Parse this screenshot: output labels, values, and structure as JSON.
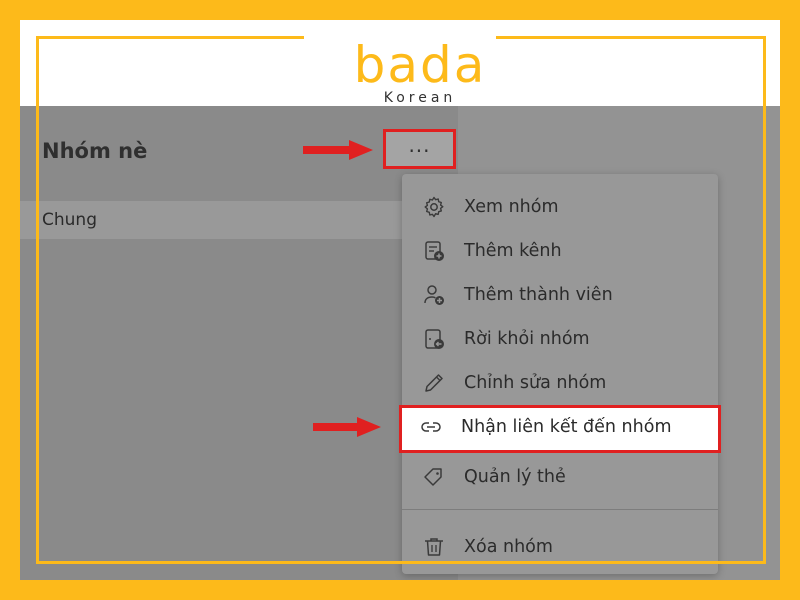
{
  "brand": {
    "logo_main": "bada",
    "logo_sub": "Korean",
    "accent_color": "#FDBA1A",
    "highlight_color": "#E02020"
  },
  "team": {
    "title": "Nhóm nè",
    "more_label": "...",
    "channels": [
      {
        "label": "Chung"
      }
    ]
  },
  "menu": {
    "items": [
      {
        "label": "Xem nhóm",
        "icon": "gear-icon"
      },
      {
        "label": "Thêm kênh",
        "icon": "add-channel-icon"
      },
      {
        "label": "Thêm thành viên",
        "icon": "add-member-icon"
      },
      {
        "label": "Rời khỏi nhóm",
        "icon": "leave-team-icon"
      },
      {
        "label": "Chỉnh sửa nhóm",
        "icon": "pencil-icon"
      },
      {
        "label": "Nhận liên kết đến nhóm",
        "icon": "link-icon"
      },
      {
        "label": "Quản lý thẻ",
        "icon": "tag-icon"
      },
      {
        "label": "Xóa nhóm",
        "icon": "trash-icon"
      }
    ]
  }
}
